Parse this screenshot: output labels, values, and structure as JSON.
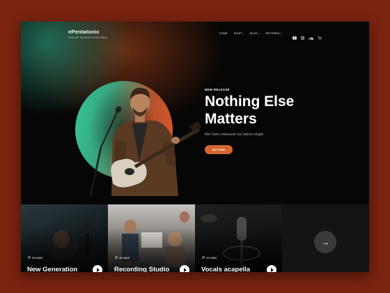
{
  "brand": {
    "name": "ePentatonic",
    "tagline": "Music WP Theme for Full Site Editing"
  },
  "nav": {
    "items": [
      {
        "label": "HOME",
        "dropdown": false
      },
      {
        "label": "SHOP",
        "dropdown": true
      },
      {
        "label": "BLOG",
        "dropdown": true
      },
      {
        "label": "PATTERNS",
        "dropdown": true
      }
    ],
    "icons": [
      "youtube-icon",
      "instagram-icon",
      "soundcloud-icon",
      "cart-icon"
    ]
  },
  "hero": {
    "eyebrow": "NEW RELEASE",
    "title": "Nothing Else Matters",
    "subtitle": "We have released our latest single",
    "cta_label": "BUY NOW"
  },
  "cards": [
    {
      "duration": "30 MINS",
      "title": "New Generation"
    },
    {
      "duration": "40 MINS",
      "title": "Recording Studio"
    },
    {
      "duration": "20 MINS",
      "title": "Vocals acapella"
    }
  ],
  "next_arrow": "→",
  "colors": {
    "accent": "#d4662f",
    "page_bg": "#7a2310",
    "teal": "#34c79b",
    "orange": "#e1572c"
  }
}
